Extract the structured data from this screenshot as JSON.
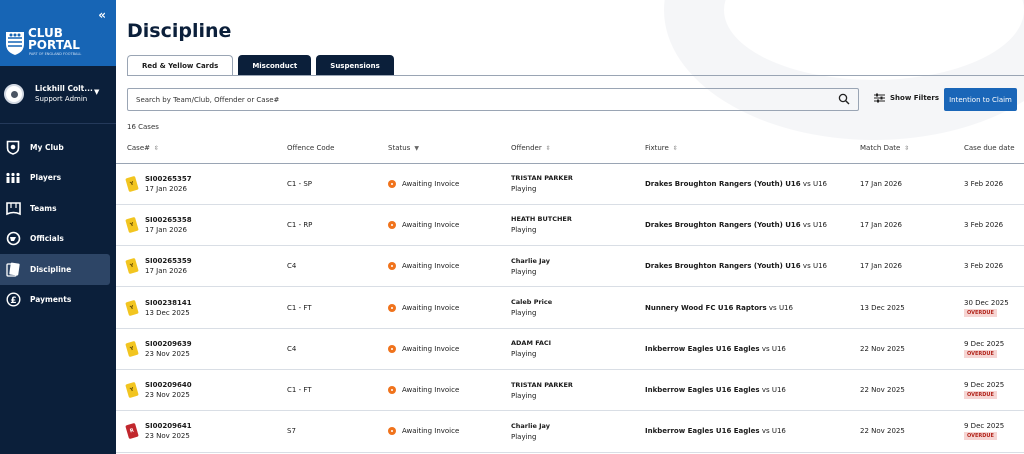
{
  "sidebar": {
    "collapse_label": "«",
    "logo": {
      "club": "CLUB",
      "portal": "PORTAL",
      "subtitle": "PART OF ENGLAND FOOTBALL"
    },
    "user": {
      "name": "Lickhill Colt...",
      "role": "Support Admin"
    },
    "items": [
      {
        "label": "My Club",
        "icon": "shield-icon",
        "active": false
      },
      {
        "label": "Players",
        "icon": "players-icon",
        "active": false
      },
      {
        "label": "Teams",
        "icon": "teams-shirt-icon",
        "active": false
      },
      {
        "label": "Officials",
        "icon": "whistle-icon",
        "active": false
      },
      {
        "label": "Discipline",
        "icon": "cards-icon",
        "active": true
      },
      {
        "label": "Payments",
        "icon": "pound-icon",
        "active": false
      }
    ]
  },
  "main": {
    "title": "Discipline",
    "tabs": [
      {
        "label": "Red & Yellow Cards",
        "active": true
      },
      {
        "label": "Misconduct",
        "active": false
      },
      {
        "label": "Suspensions",
        "active": false
      }
    ],
    "search": {
      "placeholder": "Search by Team/Club, Offender or Case#"
    },
    "filters_label": "Show Filters",
    "claim_button": "Intention to Claim",
    "count": "16 Cases",
    "columns": [
      "Case#",
      "Offence Code",
      "Status",
      "Offender",
      "Fixture",
      "Match Date",
      "Case due date"
    ],
    "rows": [
      {
        "card": "yellow",
        "card_glyph": "Y",
        "case": "SI00265357",
        "case_date": "17 Jan 2026",
        "code": "C1 - SP",
        "status": "Awaiting Invoice",
        "offender": "TRISTAN PARKER",
        "offender_status": "Playing",
        "fixture_home": "Drakes Broughton Rangers (Youth) U16",
        "fixture_vs": "vs",
        "fixture_away": "U16",
        "match_date": "17 Jan 2026",
        "due_date": "3 Feb 2026",
        "overdue": ""
      },
      {
        "card": "yellow",
        "card_glyph": "Y",
        "case": "SI00265358",
        "case_date": "17 Jan 2026",
        "code": "C1 - RP",
        "status": "Awaiting Invoice",
        "offender": "HEATH BUTCHER",
        "offender_status": "Playing",
        "fixture_home": "Drakes Broughton Rangers (Youth) U16",
        "fixture_vs": "vs",
        "fixture_away": "U16",
        "match_date": "17 Jan 2026",
        "due_date": "3 Feb 2026",
        "overdue": ""
      },
      {
        "card": "yellow",
        "card_glyph": "Y",
        "case": "SI00265359",
        "case_date": "17 Jan 2026",
        "code": "C4",
        "status": "Awaiting Invoice",
        "offender": "Charlie Jay",
        "offender_status": "Playing",
        "fixture_home": "Drakes Broughton Rangers (Youth) U16",
        "fixture_vs": "vs",
        "fixture_away": "U16",
        "match_date": "17 Jan 2026",
        "due_date": "3 Feb 2026",
        "overdue": ""
      },
      {
        "card": "yellow",
        "card_glyph": "Y",
        "case": "SI00238141",
        "case_date": "13 Dec 2025",
        "code": "C1 - FT",
        "status": "Awaiting Invoice",
        "offender": "Caleb Price",
        "offender_status": "Playing",
        "fixture_home": "Nunnery Wood FC U16 Raptors",
        "fixture_vs": "vs",
        "fixture_away": "U16",
        "match_date": "13 Dec 2025",
        "due_date": "30 Dec 2025",
        "overdue": "OVERDUE"
      },
      {
        "card": "yellow",
        "card_glyph": "Y",
        "case": "SI00209639",
        "case_date": "23 Nov 2025",
        "code": "C4",
        "status": "Awaiting Invoice",
        "offender": "ADAM FACI",
        "offender_status": "Playing",
        "fixture_home": "Inkberrow Eagles U16 Eagles",
        "fixture_vs": "vs",
        "fixture_away": "U16",
        "match_date": "22 Nov 2025",
        "due_date": "9 Dec 2025",
        "overdue": "OVERDUE"
      },
      {
        "card": "yellow",
        "card_glyph": "Y",
        "case": "SI00209640",
        "case_date": "23 Nov 2025",
        "code": "C1 - FT",
        "status": "Awaiting Invoice",
        "offender": "TRISTAN PARKER",
        "offender_status": "Playing",
        "fixture_home": "Inkberrow Eagles U16 Eagles",
        "fixture_vs": "vs",
        "fixture_away": "U16",
        "match_date": "22 Nov 2025",
        "due_date": "9 Dec 2025",
        "overdue": "OVERDUE"
      },
      {
        "card": "red",
        "card_glyph": "R",
        "case": "SI00209641",
        "case_date": "23 Nov 2025",
        "code": "S7",
        "status": "Awaiting Invoice",
        "offender": "Charlie Jay",
        "offender_status": "Playing",
        "fixture_home": "Inkberrow Eagles U16 Eagles",
        "fixture_vs": "vs",
        "fixture_away": "U16",
        "match_date": "22 Nov 2025",
        "due_date": "9 Dec 2025",
        "overdue": "OVERDUE"
      }
    ]
  },
  "colors": {
    "sidebar": "#0b1f3a",
    "logo_bg": "#1765b5",
    "primary_button": "#1a66b8",
    "status_dot": "#f0731c",
    "yellow_card": "#f2c520",
    "red_card": "#c1272d",
    "overdue_bg": "#f6d5d3",
    "overdue_text": "#b2261d"
  }
}
